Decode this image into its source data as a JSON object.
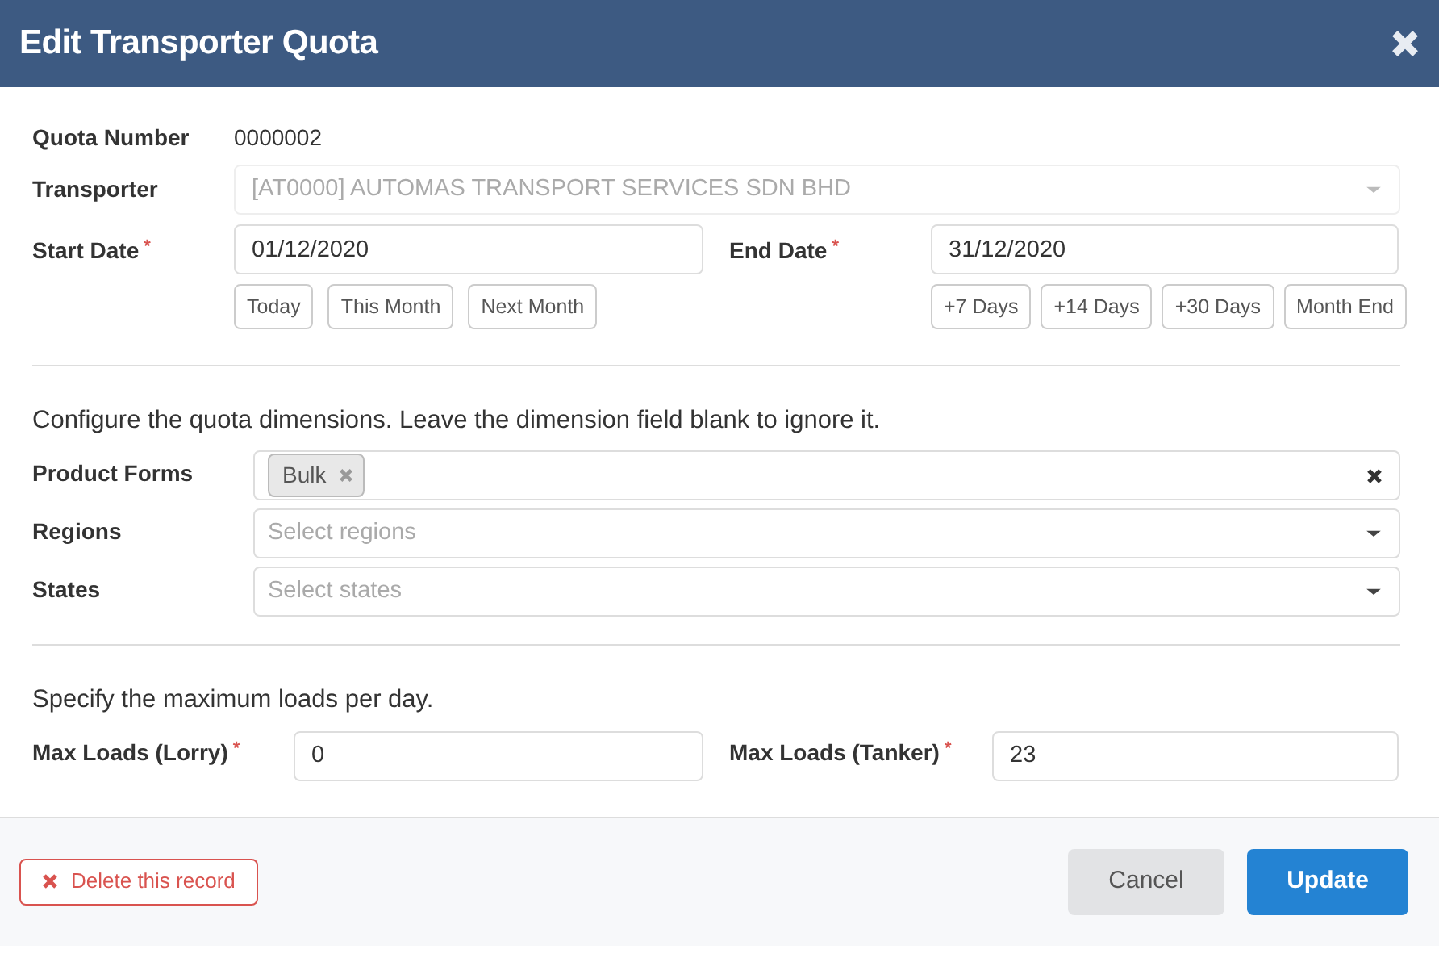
{
  "dialog": {
    "title": "Edit Transporter Quota"
  },
  "quota_number": {
    "label": "Quota Number",
    "value": "0000002"
  },
  "transporter": {
    "label": "Transporter",
    "value": "[AT0000] AUTOMAS TRANSPORT SERVICES SDN BHD",
    "disabled": true
  },
  "dates": [
    {
      "label": "Start Date",
      "required_mark": "*",
      "value": "01/12/2020",
      "shortcuts": [
        "Today",
        "This Month",
        "Next Month"
      ]
    },
    {
      "label": "End Date",
      "required_mark": "*",
      "value": "31/12/2020",
      "shortcuts": [
        "+7 Days",
        "+14 Days",
        "+30 Days",
        "Month End"
      ]
    }
  ],
  "dimensions": {
    "note": "Configure the quota dimensions. Leave the dimension field blank to ignore it.",
    "fields": [
      {
        "label": "Product Forms",
        "tags": [
          "Bulk"
        ]
      },
      {
        "label": "Regions",
        "placeholder": "Select regions"
      },
      {
        "label": "States",
        "placeholder": "Select states"
      }
    ]
  },
  "loads": {
    "note": "Specify the maximum loads per day.",
    "fields": [
      {
        "label": "Max Loads (Lorry)",
        "required_mark": "*",
        "value": "0"
      },
      {
        "label": "Max Loads (Tanker)",
        "required_mark": "*",
        "value": "23"
      }
    ]
  },
  "footer": {
    "delete_button": "Delete this record",
    "cancel_button": "Cancel",
    "update_button": "Update"
  }
}
